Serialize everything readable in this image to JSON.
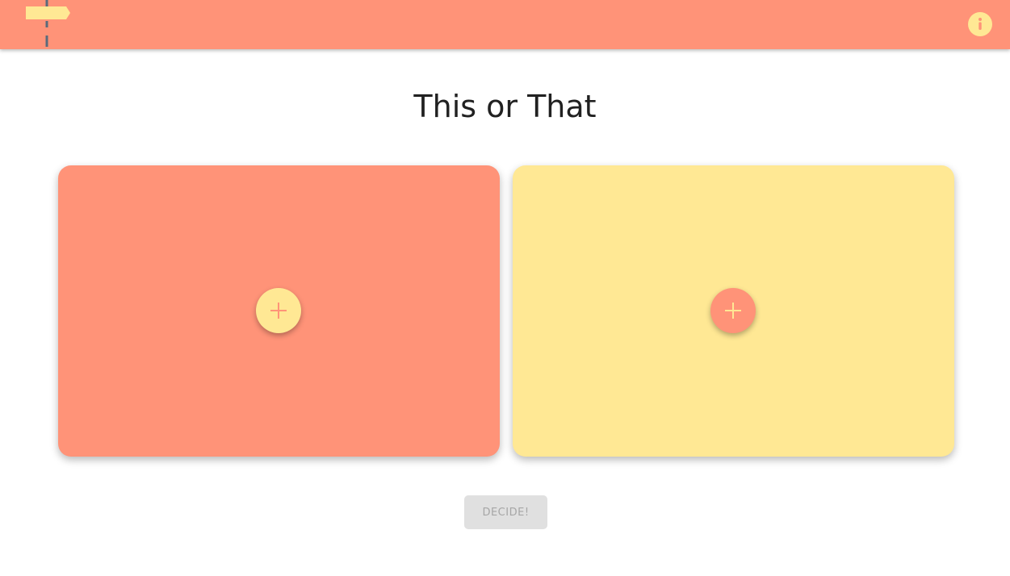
{
  "header": {
    "logo_icon": "signpost-icon",
    "info_icon": "info-icon",
    "bar_color": "#ff9378"
  },
  "page": {
    "title": "This or That"
  },
  "options": [
    {
      "card_color": "#ff9378",
      "button_icon": "plus-icon",
      "button_color": "#ffe894"
    },
    {
      "card_color": "#ffe894",
      "button_icon": "plus-icon",
      "button_color": "#ff9378"
    }
  ],
  "actions": {
    "decide_label": "DECIDE!",
    "decide_disabled": true
  },
  "colors": {
    "salmon": "#ff9378",
    "yellow": "#ffe894",
    "post": "#5b6b7b"
  }
}
